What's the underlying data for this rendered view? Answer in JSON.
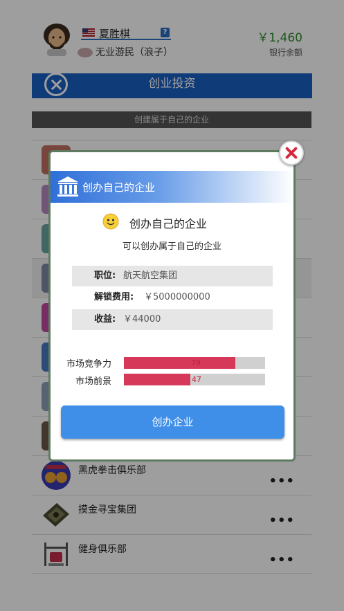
{
  "header": {
    "user_name": "夏胜棋",
    "status_text": "无业游民（浪子）",
    "balance": "￥1,460",
    "balance_label": "银行余额",
    "help_label": "?"
  },
  "titlebar": {
    "title": "创业投资"
  },
  "subbar": {
    "text": "创建属于自己的企业"
  },
  "list": {
    "items": [
      {
        "label": "",
        "more": "•••"
      },
      {
        "label": "",
        "more": "•••"
      },
      {
        "label": "",
        "more": "•••"
      },
      {
        "label": "",
        "more": "•••"
      },
      {
        "label": "",
        "more": "•••"
      },
      {
        "label": "",
        "more": "•••"
      },
      {
        "label": "",
        "more": "•••"
      },
      {
        "label": "",
        "more": "•••"
      },
      {
        "label": "黑虎拳击俱乐部",
        "more": "•••"
      },
      {
        "label": "摸金寻宝集团",
        "more": "•••"
      },
      {
        "label": "健身俱乐部",
        "more": "•••"
      }
    ]
  },
  "dialog": {
    "header": "创办自己的企业",
    "title": "创办自己的企业",
    "description": "可以创办属于自己的企业",
    "info": {
      "position_key": "职位:",
      "position_val": "航天航空集团",
      "unlock_key": "解锁费用:",
      "unlock_val": "￥5000000000",
      "profit_key": "收益:",
      "profit_val": "￥44000"
    },
    "bars": {
      "competitiveness_label": "市场竞争力",
      "competitiveness_value": "79",
      "competitiveness_pct": 79,
      "prospect_label": "市场前景",
      "prospect_value": "47",
      "prospect_pct": 47
    },
    "button_label": "创办企业"
  },
  "colors": {
    "primary_blue": "#1a5fc4",
    "button_blue": "#3f8ee8",
    "bar_red": "#d6385a",
    "balance_green": "#2e8b2e"
  }
}
